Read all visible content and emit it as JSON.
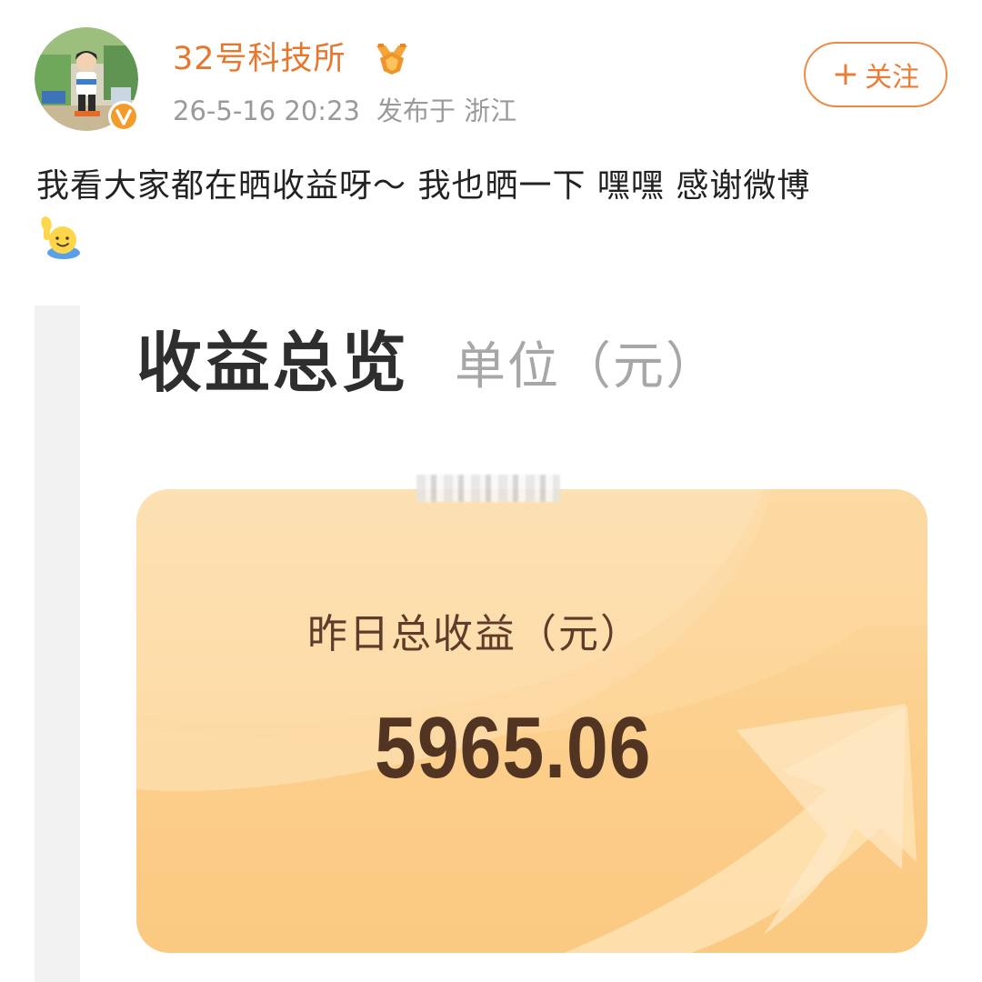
{
  "post": {
    "author": "32号科技所",
    "timestamp": "26-5-16 20:23",
    "location": "发布于 浙江",
    "follow_label": "关注",
    "follow_plus": "+",
    "text": "我看大家都在晒收益呀～ 我也晒一下 嘿嘿 感谢微博"
  },
  "icons": {
    "verified": "v-verified-badge-icon",
    "medal": "medal-icon",
    "emoji": "waving-hand-emoji-icon"
  },
  "earnings_screenshot": {
    "title": "收益总览",
    "unit": "单位（元）",
    "card": {
      "label": "昨日总收益（元）",
      "amount": "5965.06"
    }
  },
  "colors": {
    "author": "#e8772e",
    "follow_border": "#ee8a43",
    "meta": "#9a9a9a",
    "card_top": "#fddba6",
    "card_bottom": "#fbc981",
    "amount": "#523422"
  }
}
